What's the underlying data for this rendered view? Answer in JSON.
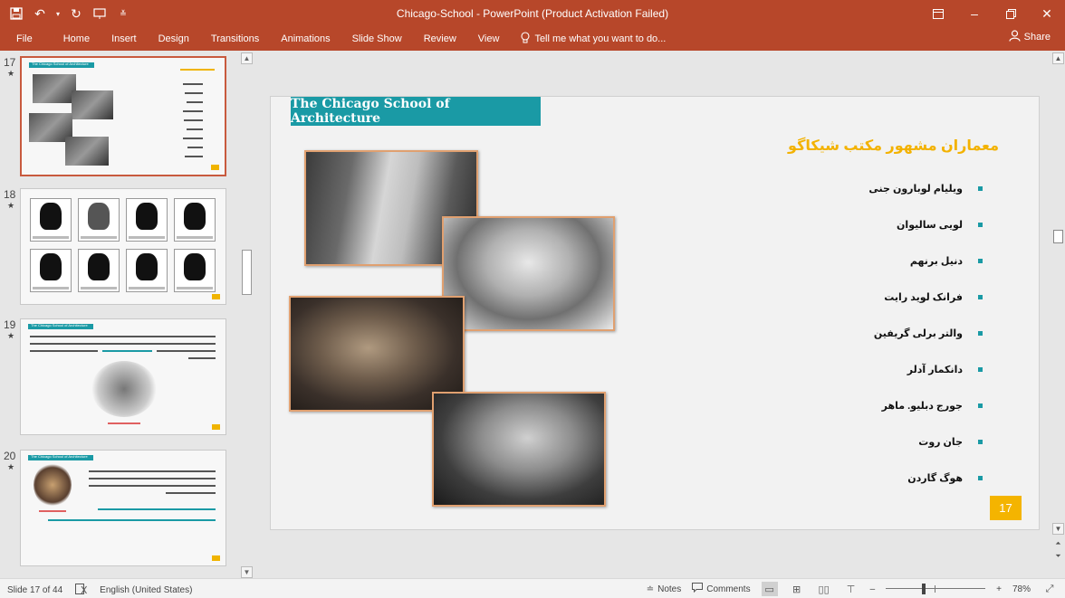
{
  "window": {
    "title": "Chicago-School - PowerPoint (Product Activation Failed)"
  },
  "ribbon": {
    "tabs": [
      "File",
      "Home",
      "Insert",
      "Design",
      "Transitions",
      "Animations",
      "Slide Show",
      "Review",
      "View"
    ],
    "tell_me": "Tell me what you want to do...",
    "share": "Share"
  },
  "thumbnails": [
    {
      "number": "17",
      "star": "★",
      "selected": true
    },
    {
      "number": "18",
      "star": "★"
    },
    {
      "number": "19",
      "star": "★"
    },
    {
      "number": "20",
      "star": "★"
    }
  ],
  "slide": {
    "title": "The Chicago School of Architecture",
    "heading": "معماران مشهور مکتب شیکاگو",
    "names": [
      "ویلیام لوبارون جنی",
      "لویی سالیوان",
      "دنیل برنهم",
      "فرانک لوید رایت",
      "والتر برلی گریفین",
      "دانکمار آدلر",
      "جورج دبلیو. ماهر",
      "جان روت",
      "هوگ گاردن"
    ],
    "page_number": "17",
    "accent_color": "#1a9aa5",
    "heading_color": "#f3b200"
  },
  "status": {
    "slide_info": "Slide 17 of 44",
    "language": "English (United States)",
    "notes": "Notes",
    "comments": "Comments",
    "zoom": "78%",
    "zoom_fraction": 0.78
  }
}
